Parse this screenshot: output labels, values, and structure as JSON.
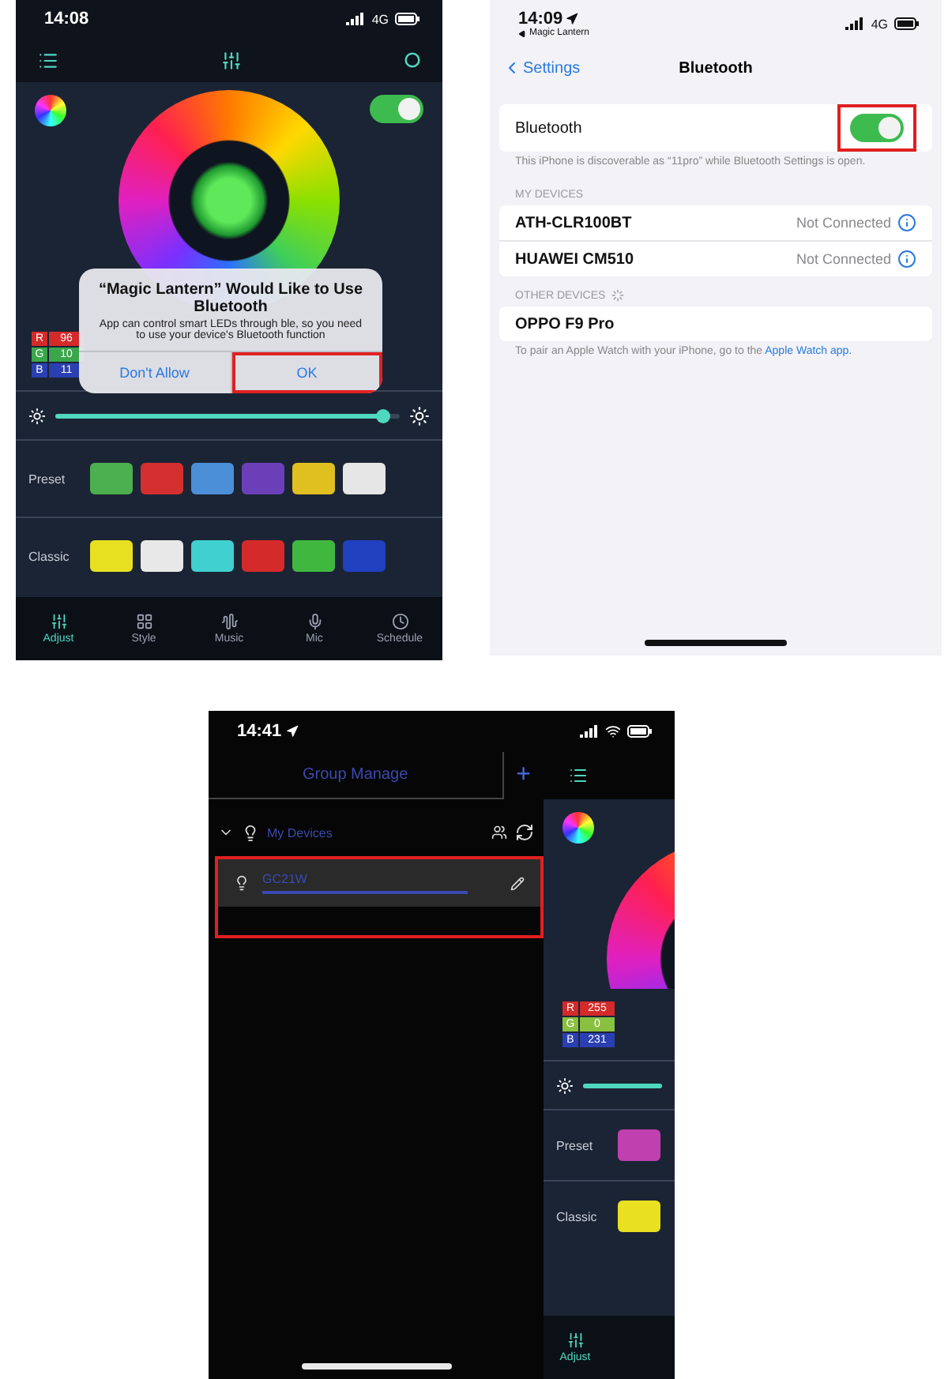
{
  "app_screen": {
    "status_bar": {
      "time": "14:08",
      "network": "4G"
    },
    "power_on": true,
    "rgb": [
      {
        "label": "R",
        "value": "96",
        "color": "#d42a2a"
      },
      {
        "label": "G",
        "value": "10",
        "color": "#3aa64a"
      },
      {
        "label": "B",
        "value": "11",
        "color": "#2a3fb0"
      }
    ],
    "brightness": {
      "level": 0.95
    },
    "preset": {
      "label": "Preset",
      "swatches": [
        {
          "color": "#4caf50"
        },
        {
          "color": "#d32f2f"
        },
        {
          "color": "#4a8fd8"
        },
        {
          "color": "#6a3fb8"
        },
        {
          "color": "#e0c020"
        },
        {
          "color": "#e6e6e6"
        }
      ]
    },
    "classic": {
      "label": "Classic",
      "swatches": [
        {
          "color": "#e6e020"
        },
        {
          "color": "#e8e8e8"
        },
        {
          "color": "#40d0d0"
        },
        {
          "color": "#d42a2a"
        },
        {
          "color": "#40b840"
        },
        {
          "color": "#2040c0"
        }
      ]
    },
    "tabs": [
      {
        "label": "Adjust",
        "selected": true
      },
      {
        "label": "Style",
        "selected": false
      },
      {
        "label": "Music",
        "selected": false
      },
      {
        "label": "Mic",
        "selected": false
      },
      {
        "label": "Schedule",
        "selected": false
      }
    ],
    "dialog": {
      "title": "“Magic Lantern” Would Like to Use Bluetooth",
      "message": "App can control smart LEDs through ble, so you need to use your device's Bluetooth function",
      "buttons": [
        {
          "label": "Don't Allow",
          "highlighted": false
        },
        {
          "label": "OK",
          "highlighted": true
        }
      ]
    }
  },
  "settings_screen": {
    "status_bar": {
      "time": "14:09",
      "back_app": "Magic Lantern",
      "network": "4G"
    },
    "nav": {
      "back": "Settings",
      "title": "Bluetooth"
    },
    "bluetooth": {
      "label": "Bluetooth",
      "on": true,
      "highlighted": true
    },
    "discoverable_note": "This iPhone is discoverable as “11pro” while Bluetooth Settings is open.",
    "my_devices": {
      "header": "MY DEVICES",
      "devices": [
        {
          "name": "ATH-CLR100BT",
          "status": "Not Connected"
        },
        {
          "name": "HUAWEI CM510",
          "status": "Not Connected"
        }
      ]
    },
    "other_devices": {
      "header": "OTHER DEVICES",
      "searching": true,
      "devices": [
        {
          "name": "OPPO F9 Pro"
        }
      ]
    },
    "watch_note": {
      "text": "To pair an Apple Watch with your iPhone, go to the",
      "link": "Apple Watch app."
    }
  },
  "drawer_screen": {
    "status_bar": {
      "time": "14:41"
    },
    "drawer": {
      "title": "Group Manage",
      "add": "+",
      "group": {
        "label": "My Devices",
        "expanded": true,
        "devices": [
          {
            "name": "GC21W",
            "highlighted": true
          }
        ]
      }
    },
    "app": {
      "rgb": [
        {
          "label": "R",
          "value": "255",
          "color": "#d42a2a"
        },
        {
          "label": "G",
          "value": "0",
          "color": "#8ac040"
        },
        {
          "label": "B",
          "value": "231",
          "color": "#2a3fb0"
        }
      ],
      "brightness": {
        "level": 1
      },
      "preset": {
        "label": "Preset",
        "color": "#c040b0"
      },
      "classic": {
        "label": "Classic",
        "color": "#e8e020"
      },
      "tabs": [
        {
          "label": "Adjust",
          "selected": true
        }
      ]
    }
  }
}
